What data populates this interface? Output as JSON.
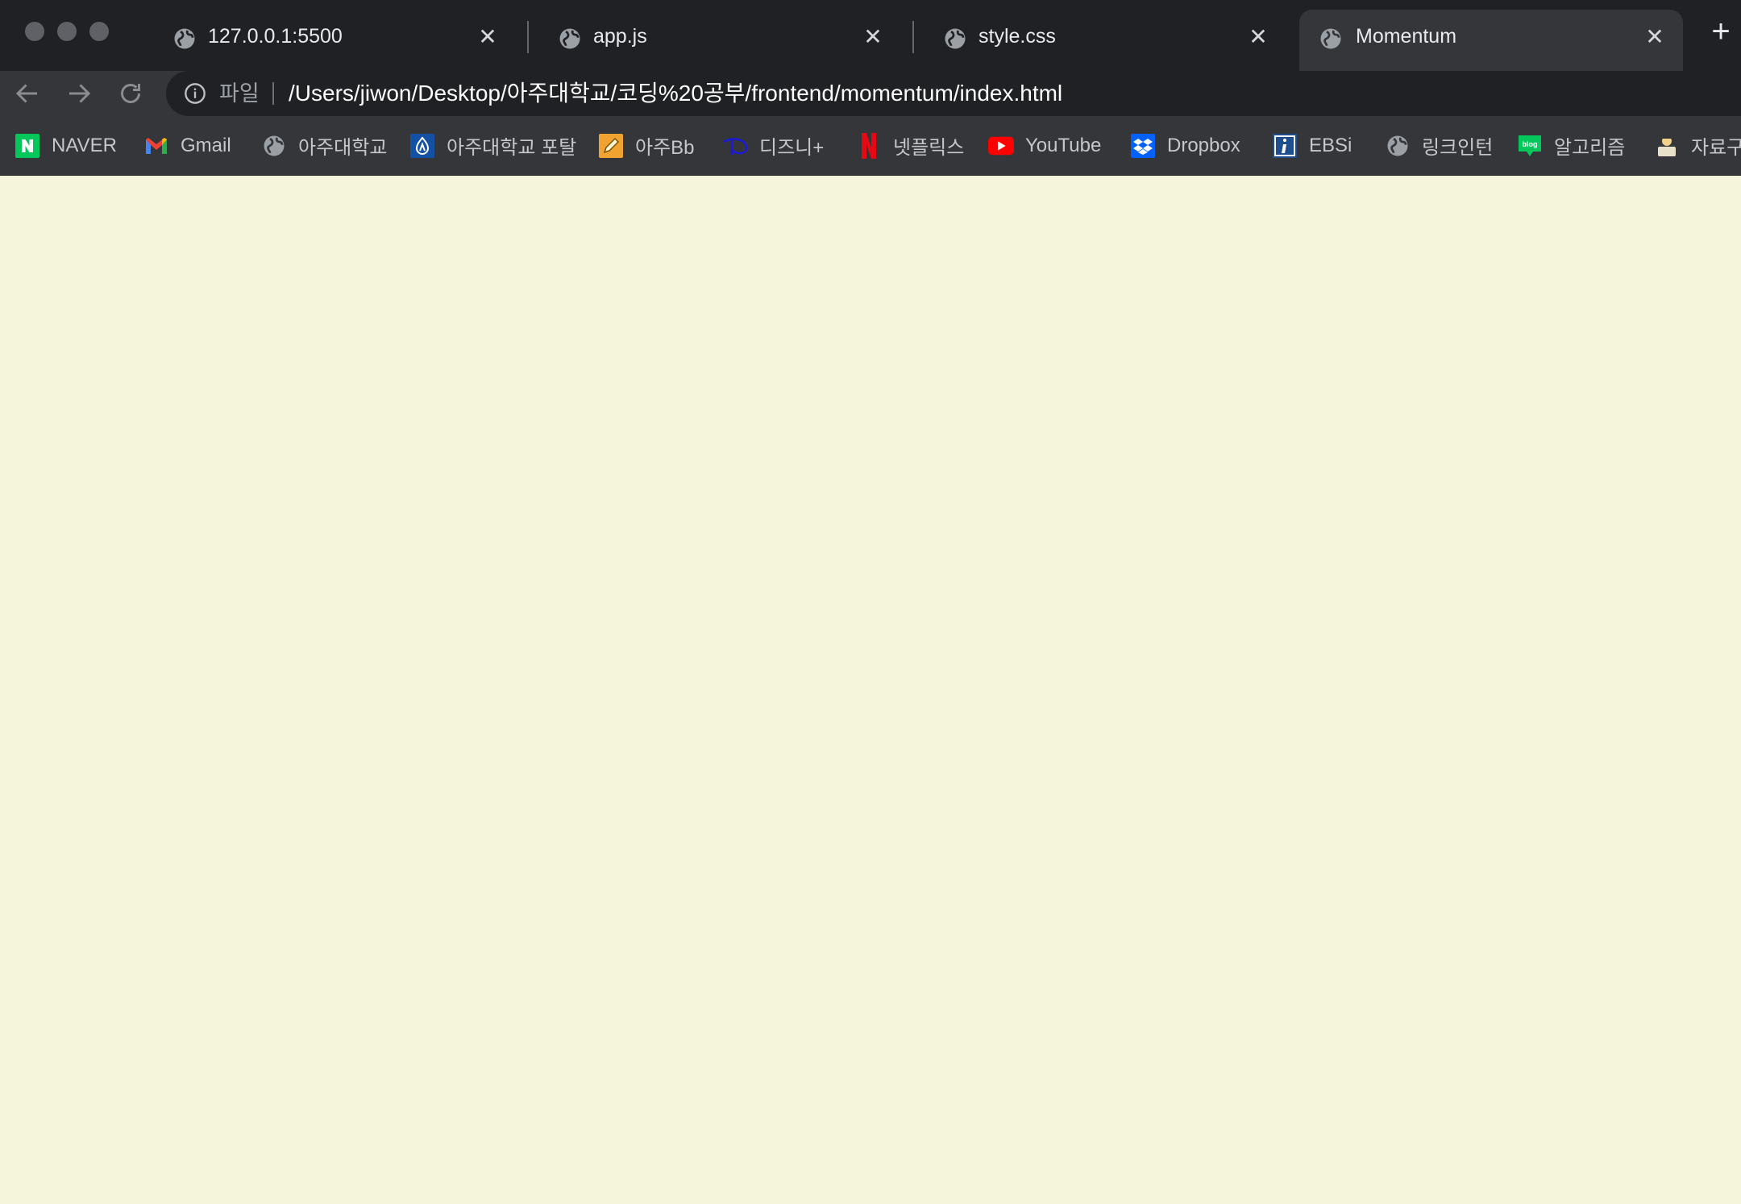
{
  "tabs": [
    {
      "title": "127.0.0.1:5500",
      "active": false
    },
    {
      "title": "app.js",
      "active": false
    },
    {
      "title": "style.css",
      "active": false
    },
    {
      "title": "Momentum",
      "active": true
    }
  ],
  "toolbar": {
    "scheme_label": "파일",
    "url": "/Users/jiwon/Desktop/아주대학교/코딩%20공부/frontend/momentum/index.html"
  },
  "bookmarks": [
    {
      "label": "NAVER",
      "icon": "naver-icon"
    },
    {
      "label": "Gmail",
      "icon": "gmail-icon"
    },
    {
      "label": "아주대학교",
      "icon": "globe-icon"
    },
    {
      "label": "아주대학교 포탈",
      "icon": "ajou-portal-icon"
    },
    {
      "label": "아주Bb",
      "icon": "pencil-icon"
    },
    {
      "label": "디즈니+",
      "icon": "disney-icon"
    },
    {
      "label": "넷플릭스",
      "icon": "netflix-icon"
    },
    {
      "label": "YouTube",
      "icon": "youtube-icon"
    },
    {
      "label": "Dropbox",
      "icon": "dropbox-icon"
    },
    {
      "label": "EBSi",
      "icon": "ebsi-icon"
    },
    {
      "label": "링크인턴",
      "icon": "globe-icon"
    },
    {
      "label": "알고리즘",
      "icon": "blog-icon"
    },
    {
      "label": "자료구",
      "icon": "folder-person-icon"
    }
  ],
  "colors": {
    "page_background": "#f5f5dc",
    "tab_strip": "#202124",
    "toolbar": "#35363a"
  }
}
